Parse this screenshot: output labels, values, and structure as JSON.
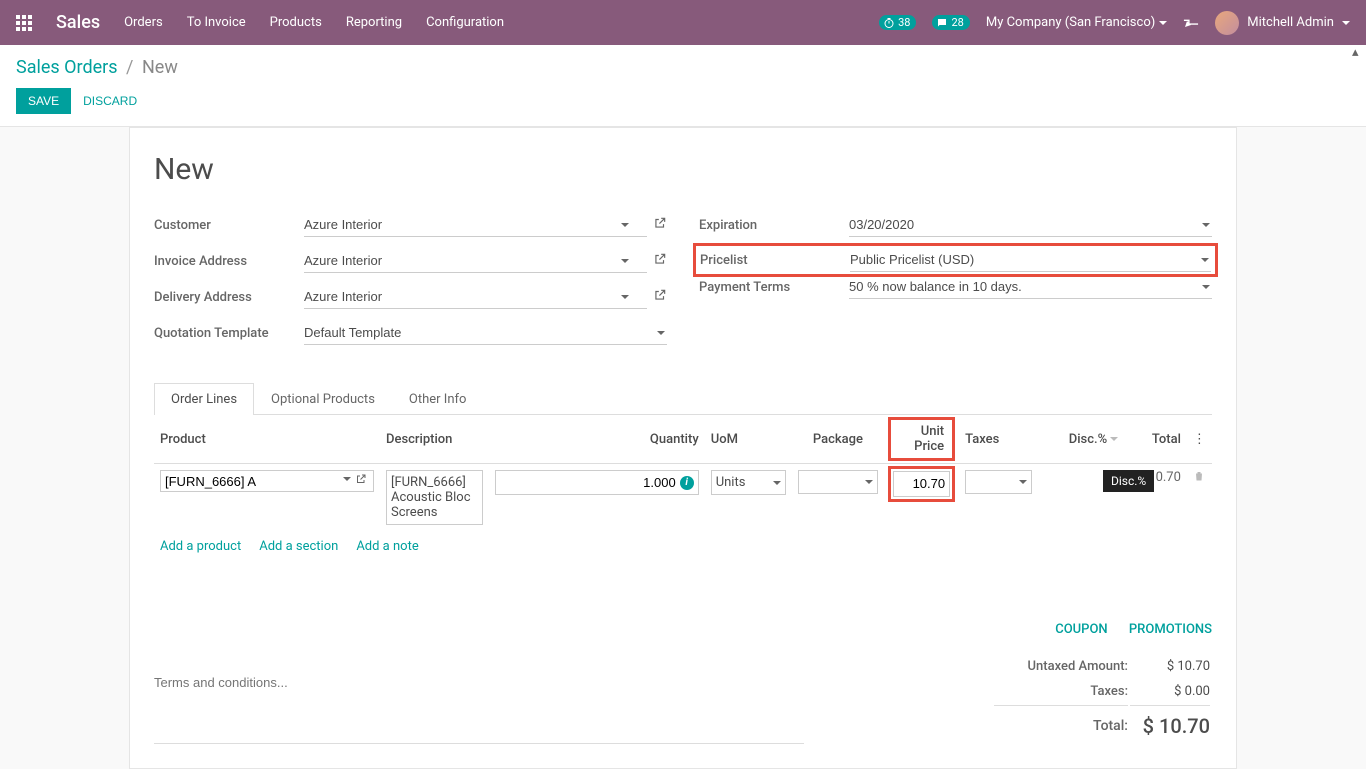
{
  "navbar": {
    "brand": "Sales",
    "menu": [
      "Orders",
      "To Invoice",
      "Products",
      "Reporting",
      "Configuration"
    ],
    "timer_badge": "38",
    "chat_badge": "28",
    "company": "My Company (San Francisco)",
    "user": "Mitchell Admin"
  },
  "breadcrumb": {
    "root": "Sales Orders",
    "current": "New"
  },
  "buttons": {
    "save": "Save",
    "discard": "Discard"
  },
  "title": "New",
  "fields": {
    "customer_label": "Customer",
    "customer": "Azure Interior",
    "invoice_addr_label": "Invoice Address",
    "invoice_addr": "Azure Interior",
    "delivery_addr_label": "Delivery Address",
    "delivery_addr": "Azure Interior",
    "quote_tpl_label": "Quotation Template",
    "quote_tpl": "Default Template",
    "expiration_label": "Expiration",
    "expiration": "03/20/2020",
    "pricelist_label": "Pricelist",
    "pricelist": "Public Pricelist (USD)",
    "payment_terms_label": "Payment Terms",
    "payment_terms": "50 % now balance in 10 days."
  },
  "tabs": [
    "Order Lines",
    "Optional Products",
    "Other Info"
  ],
  "columns": {
    "product": "Product",
    "description": "Description",
    "quantity": "Quantity",
    "uom": "UoM",
    "package": "Package",
    "unit_price": "Unit Price",
    "taxes": "Taxes",
    "disc": "Disc.%",
    "total": "Total"
  },
  "line": {
    "product_code": "[FURN_6666] A",
    "description": "[FURN_6666] Acoustic Bloc Screens",
    "quantity": "1.000",
    "uom": "Units",
    "unit_price": "10.70",
    "total": "10.70"
  },
  "line_actions": {
    "add_product": "Add a product",
    "add_section": "Add a section",
    "add_note": "Add a note"
  },
  "tooltip_disc": "Disc.%",
  "terms_placeholder": "Terms and conditions...",
  "promo": {
    "coupon": "COUPON",
    "promotions": "PROMOTIONS"
  },
  "totals": {
    "untaxed_label": "Untaxed Amount:",
    "untaxed": "$ 10.70",
    "taxes_label": "Taxes:",
    "taxes": "$ 0.00",
    "total_label": "Total:",
    "total": "$ 10.70"
  }
}
